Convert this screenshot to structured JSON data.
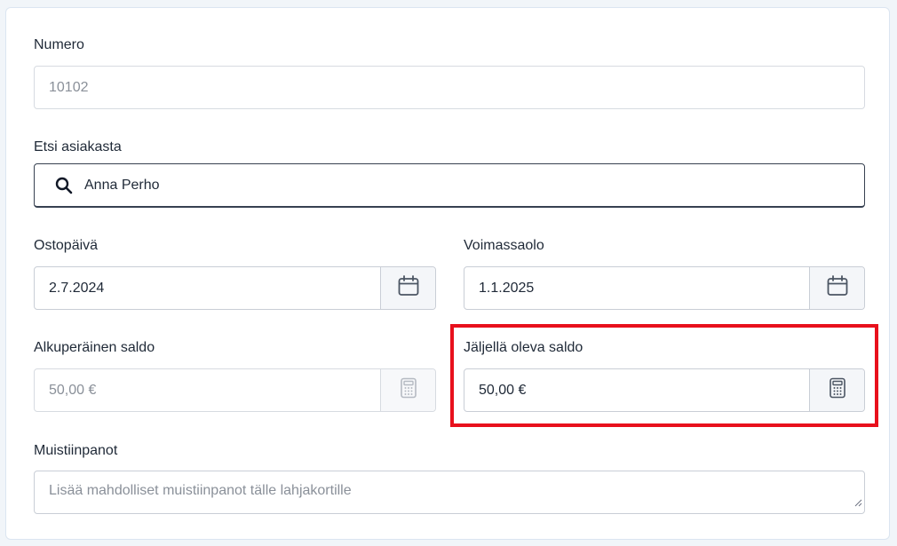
{
  "form": {
    "numero": {
      "label": "Numero",
      "value": "10102"
    },
    "customer_search": {
      "label": "Etsi asiakasta",
      "value": "Anna Perho",
      "icon": "search-icon"
    },
    "purchase_date": {
      "label": "Ostopäivä",
      "value": "2.7.2024",
      "icon": "calendar-icon"
    },
    "validity": {
      "label": "Voimassaolo",
      "value": "1.1.2025",
      "icon": "calendar-icon"
    },
    "original_balance": {
      "label": "Alkuperäinen saldo",
      "value": "50,00 €",
      "icon": "calculator-icon"
    },
    "remaining_balance": {
      "label": "Jäljellä oleva saldo",
      "value": "50,00 €",
      "icon": "calculator-icon"
    },
    "notes": {
      "label": "Muistiinpanot",
      "placeholder": "Lisää mahdolliset muistiinpanot tälle lahjakortille"
    }
  },
  "colors": {
    "highlight": "#e8101c",
    "border": "#c9ced6",
    "disabled_text": "#8a9099",
    "text": "#1f2937"
  }
}
